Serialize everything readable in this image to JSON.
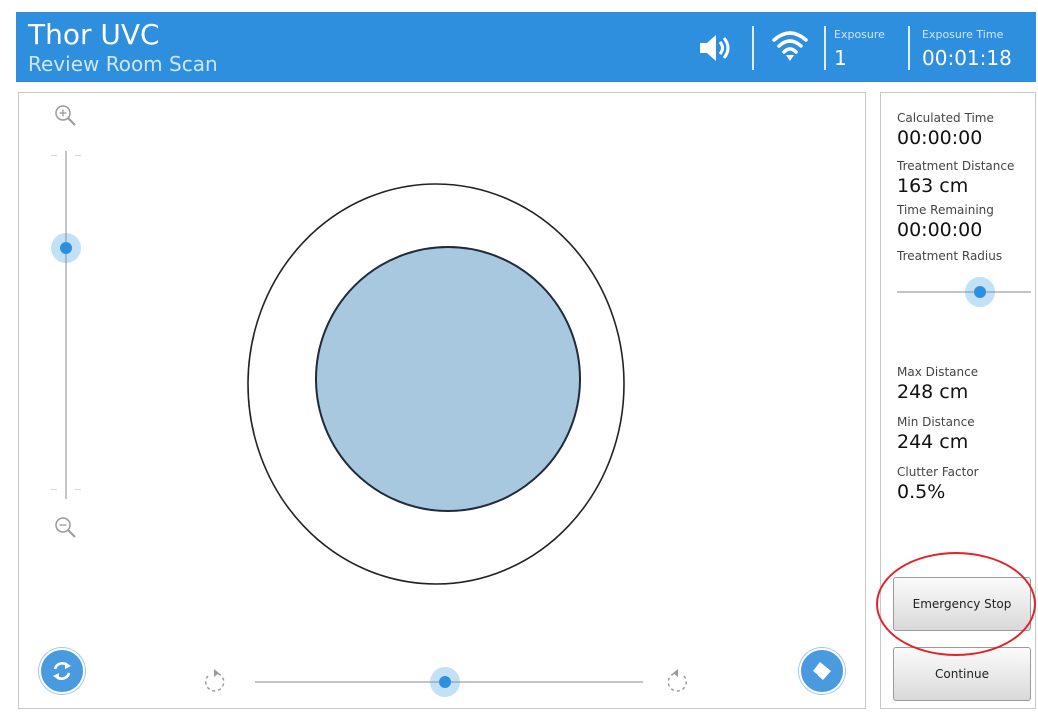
{
  "header": {
    "title": "Thor UVC",
    "subtitle": "Review Room Scan",
    "speaker_icon": "speaker-icon",
    "wifi_icon": "wifi-icon",
    "exposure_label": "Exposure",
    "exposure_value": "1",
    "exposure_time_label": "Exposure Time",
    "exposure_time_value": "00:01:18",
    "color": "#2f8fdf"
  },
  "main": {
    "zoom_in_icon": "zoom-in-icon",
    "zoom_out_icon": "zoom-out-icon",
    "zoom_level": 0.72,
    "rotate_left_icon": "rotate-left-icon",
    "rotate_right_icon": "rotate-right-icon",
    "rotation_level": 0.49,
    "refresh_button_icon": "refresh-icon",
    "erase_button_icon": "eraser-icon",
    "scan_outer_color": "#ffffff",
    "scan_inner_color": "#a8c8e0"
  },
  "stats": {
    "calculated_time_label": "Calculated Time",
    "calculated_time_value": "00:00:00",
    "treatment_distance_label": "Treatment Distance",
    "treatment_distance_value": "163 cm",
    "time_remaining_label": "Time Remaining",
    "time_remaining_value": "00:00:00",
    "treatment_radius_label": "Treatment Radius",
    "treatment_radius_level": 0.62,
    "max_distance_label": "Max Distance",
    "max_distance_value": "248 cm",
    "min_distance_label": "Min Distance",
    "min_distance_value": "244 cm",
    "clutter_factor_label": "Clutter Factor",
    "clutter_factor_value": "0.5%"
  },
  "buttons": {
    "emergency_stop_label": "Emergency Stop",
    "continue_label": "Continue",
    "highlight_color": "#e0242a"
  }
}
